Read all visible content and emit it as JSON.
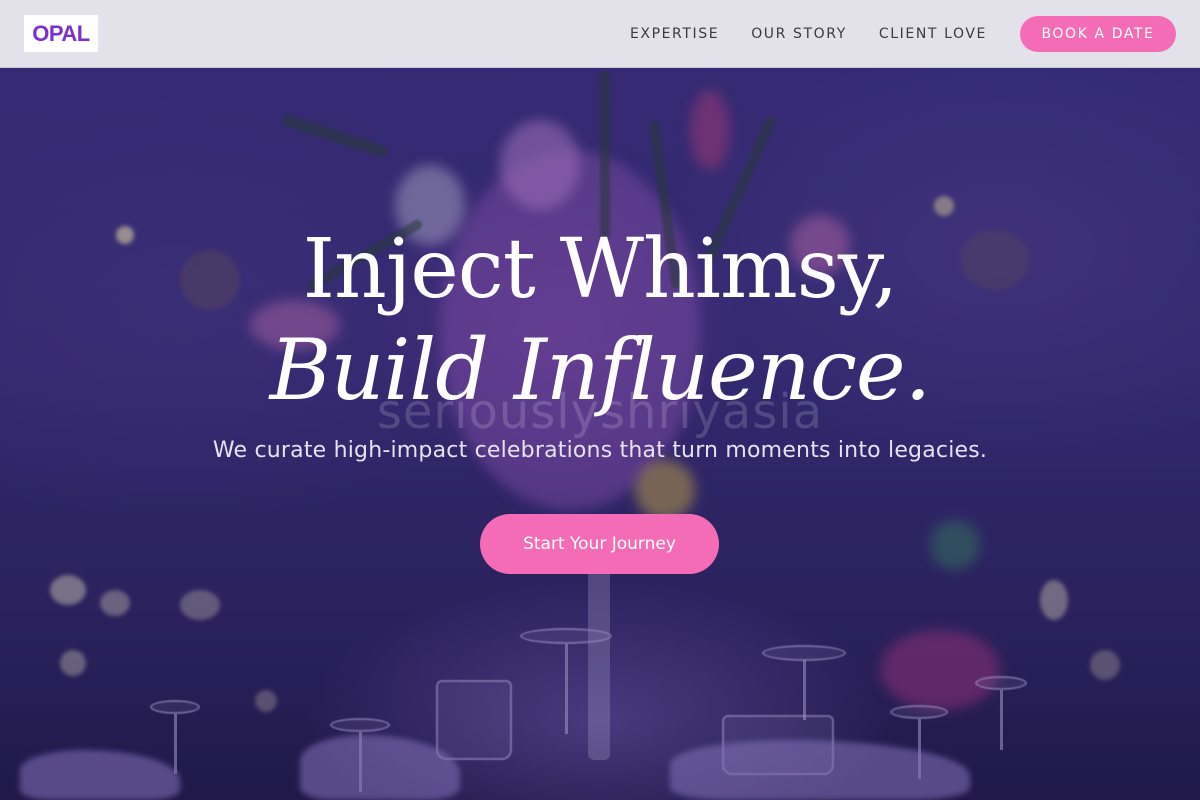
{
  "brand": {
    "logo_text": "OPAL",
    "accent_color": "#7b2fd0"
  },
  "nav": {
    "items": [
      {
        "label": "EXPERTISE"
      },
      {
        "label": "OUR STORY"
      },
      {
        "label": "CLIENT LOVE"
      }
    ],
    "cta_label": "BOOK A DATE",
    "cta_color": "#f56cb6"
  },
  "hero": {
    "headline_line1": "Inject Whimsy,",
    "headline_line2": "Build Influence.",
    "subheadline": "We curate high-impact celebrations that turn moments into legacies.",
    "watermark": "seriouslyshriyasia",
    "cta_label": "Start Your Journey",
    "cta_color": "#f56cb6",
    "background_image": "purple-lit event table with floral centerpiece and glassware"
  }
}
